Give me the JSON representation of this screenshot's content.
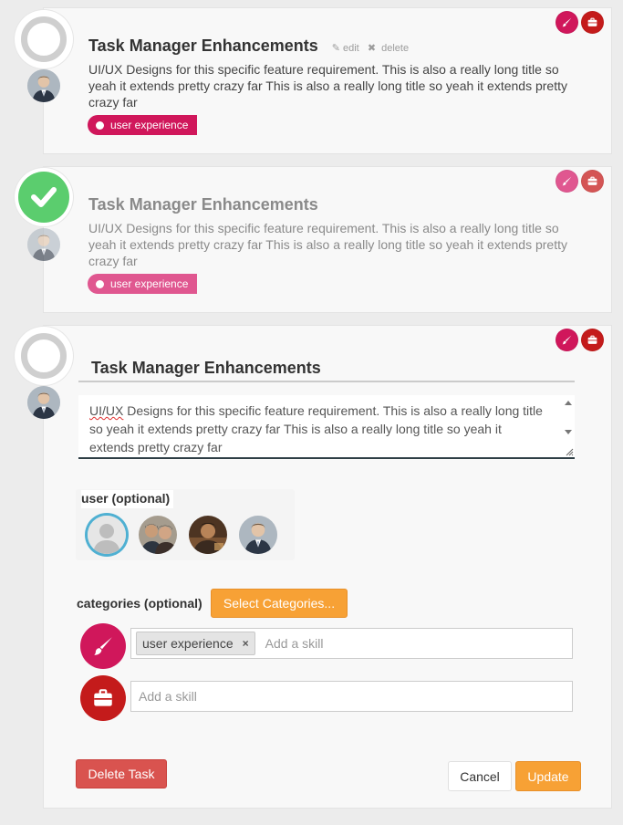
{
  "tasks": [
    {
      "title": "Task Manager Enhancements",
      "edit_label": "edit",
      "delete_label": "delete",
      "description": "UI/UX Designs for this specific feature requirement. This is also a really long title so yeah it extends pretty crazy far This is also a really long title so yeah it extends pretty crazy far",
      "tag": "user experience",
      "status": "open"
    },
    {
      "title": "Task Manager Enhancements",
      "description": "UI/UX Designs for this specific feature requirement. This is also a really long title so yeah it extends pretty crazy far This is also a really long title so yeah it extends pretty crazy far",
      "tag": "user experience",
      "status": "completed"
    }
  ],
  "editor": {
    "title_value": "Task Manager Enhancements",
    "desc_first_word": "UI/UX",
    "desc_rest": " Designs for this specific feature requirement. This is also a really long title so yeah it extends pretty crazy far This is also a really long title so yeah it extends pretty crazy far",
    "user_label": "user (optional)",
    "categories_label": "categories (optional)",
    "select_categories_label": "Select Categories...",
    "skill_chip": "user experience",
    "skill_chip_remove": "×",
    "skill_placeholder": "Add a skill",
    "delete_label": "Delete Task",
    "cancel_label": "Cancel",
    "update_label": "Update"
  },
  "colors": {
    "brush_category": "#d0175b",
    "briefcase_category": "#c41b1b",
    "accent_orange": "#f7a135",
    "danger": "#d9534f",
    "done_green": "#5bcd6e",
    "selected_ring": "#4fb0d2"
  },
  "icons": {
    "category_1": "paintbrush-icon",
    "category_2": "briefcase-icon",
    "edit": "pencil-icon",
    "delete": "x-icon",
    "status_done": "checkmark-icon"
  }
}
